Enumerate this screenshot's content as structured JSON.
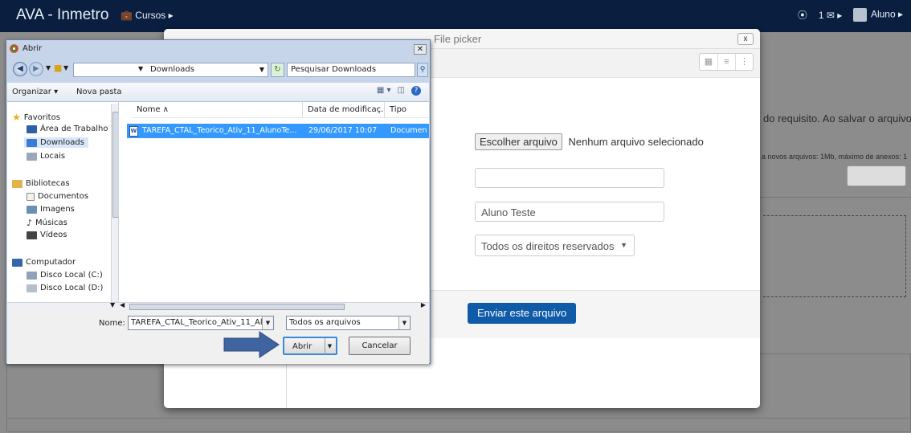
{
  "navbar": {
    "brand": "AVA - Inmetro",
    "courses": "Cursos ▸",
    "target_icon": "⦿",
    "messages": "1 ✉ ▸",
    "user": "Aluno ▸"
  },
  "background_page": {
    "text_line1": "do requisito. Ao salvar o arquivo,",
    "text_line2": "a novos arquivos: 1Mb, máximo de anexos: 1"
  },
  "file_picker": {
    "title": "File picker",
    "close": "x",
    "choose_button": "Escolher arquivo",
    "no_file": "Nenhum arquivo selecionado",
    "save_as_value": "",
    "author_value": "Aluno Teste",
    "license_value": "Todos os direitos reservados",
    "upload_button": "Enviar este arquivo"
  },
  "open_dialog": {
    "title": "Abrir",
    "address": "Downloads",
    "search_placeholder": "Pesquisar Downloads",
    "organize": "Organizar ▾",
    "new_folder": "Nova pasta",
    "nav": {
      "favorites": "Favoritos",
      "desktop": "Área de Trabalho",
      "downloads": "Downloads",
      "places": "Locais",
      "libraries": "Bibliotecas",
      "documents": "Documentos",
      "images": "Imagens",
      "music": "Músicas",
      "videos": "Vídeos",
      "computer": "Computador",
      "disk_c": "Disco Local (C:)",
      "disk_d": "Disco Local (D:)"
    },
    "columns": {
      "name": "Nome ∧",
      "date": "Data de modificaç...",
      "type": "Tipo"
    },
    "files": [
      {
        "name": "TAREFA_CTAL_Teorico_Ativ_11_AlunoTe...",
        "date": "29/06/2017 10:07",
        "type": "Documen"
      }
    ],
    "filename_label": "Nome:",
    "filename_value": "TAREFA_CTAL_Teorico_Ativ_11_Alunc",
    "filetype_value": "Todos os arquivos",
    "open_button": "Abrir",
    "cancel_button": "Cancelar"
  },
  "colors": {
    "navbar": "#0a1e3f",
    "upload_button": "#0f5ba7",
    "selected_file": "#3399ff",
    "arrow": "#3f64a0"
  }
}
